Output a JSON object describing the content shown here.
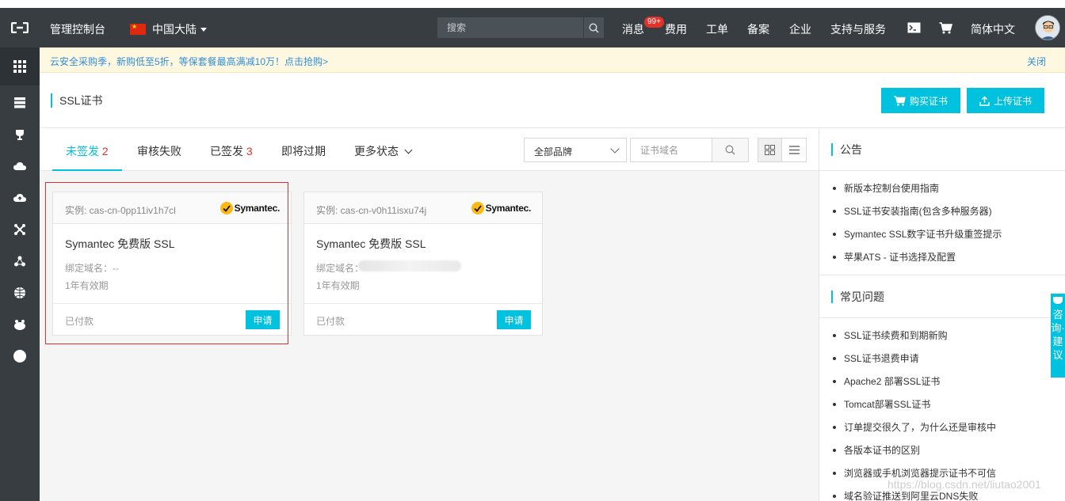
{
  "topbar": {
    "console_title": "管理控制台",
    "region": "中国大陆",
    "search_placeholder": "搜索",
    "nav": {
      "messages": "消息",
      "messages_badge": "99+",
      "billing": "费用",
      "tickets": "工单",
      "icp": "备案",
      "enterprise": "企业",
      "support": "支持与服务",
      "language": "简体中文"
    }
  },
  "notice": {
    "text": "云安全采购季，新购低至5折，等保套餐最高满减10万！点击抢购>",
    "close": "关闭"
  },
  "page": {
    "title": "SSL证书",
    "buy_button": "购买证书",
    "upload_button": "上传证书"
  },
  "tabs": [
    {
      "label": "未签发",
      "count": "2"
    },
    {
      "label": "审核失败",
      "count": ""
    },
    {
      "label": "已签发",
      "count": "3"
    },
    {
      "label": "即将过期",
      "count": ""
    },
    {
      "label": "更多状态",
      "count": ""
    }
  ],
  "filters": {
    "brand_selected": "全部品牌",
    "domain_placeholder": "证书域名"
  },
  "cards": [
    {
      "instance": "实例: cas-cn-0pp11iv1h7cl",
      "brand": "Symantec.",
      "name": "Symantec 免费版 SSL",
      "domain_label": "绑定域名：--",
      "validity": "1年有效期",
      "status": "已付款",
      "action": "申请"
    },
    {
      "instance": "实例: cas-cn-v0h11isxu74j",
      "brand": "Symantec.",
      "name": "Symantec 免费版 SSL",
      "domain_label": "绑定域名：",
      "validity": "1年有效期",
      "status": "已付款",
      "action": "申请"
    }
  ],
  "right_panel": {
    "announcements_title": "公告",
    "announcements": [
      "新版本控制台使用指南",
      "SSL证书安装指南(包含多种服务器)",
      "Symantec SSL数字证书升级重签提示",
      "苹果ATS - 证书选择及配置"
    ],
    "faq_title": "常见问题",
    "faq": [
      "SSL证书续费和到期新购",
      "SSL证书退费申请",
      "Apache2 部署SSL证书",
      "Tomcat部署SSL证书",
      "订单提交很久了，为什么还是审核中",
      "各版本证书的区别",
      "浏览器或手机浏览器提示证书不可信",
      "域名验证推送到阿里云DNS失败"
    ]
  },
  "consult": {
    "label": "咨询·建议"
  },
  "watermark": "https://blog.csdn.net/liutao2001",
  "colors": {
    "topbar": "#373d41",
    "accent": "#00c1de",
    "badge": "#e2322a",
    "link": "#2f8fd8",
    "highlight": "#e03030"
  }
}
